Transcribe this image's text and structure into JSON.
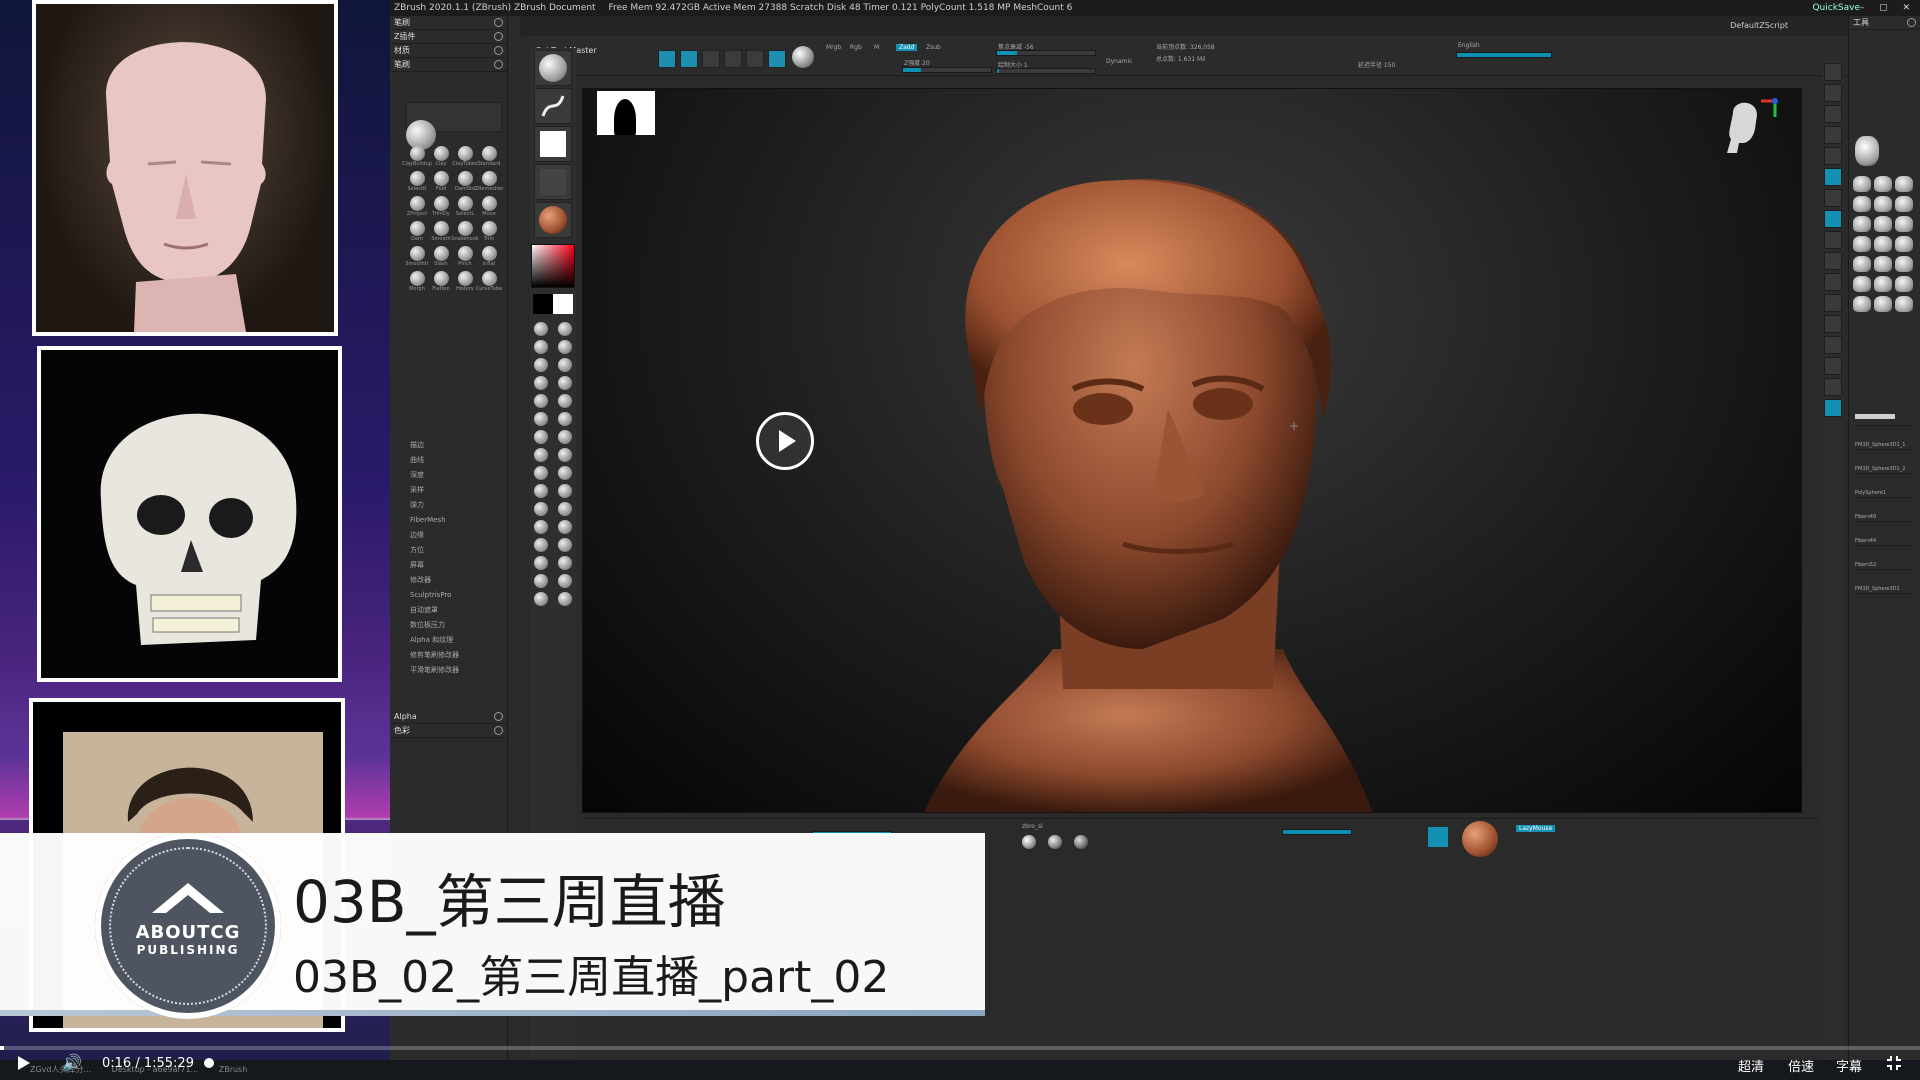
{
  "window": {
    "title": "ZBrush 2020.1.1 (ZBrush)  ZBrush Document",
    "status": "Free Mem 92.472GB  Active Mem 27388  Scratch Disk 48  Timer 0.121  PolyCount 1.518 MP  MeshCount 6",
    "quicksave": "QuickSave",
    "script": "DefaultZScript"
  },
  "left_tray": {
    "sections": [
      "笔刷",
      "Z插件",
      "材质",
      "笔刷"
    ],
    "brushes": [
      "ClayBuildup",
      "Clay",
      "ClayTubes",
      "Standard",
      "SelectR",
      "Fold",
      "DamStd",
      "ZRemesher",
      "ZProject",
      "TrimDy",
      "SelectL",
      "Move",
      "Dam",
      "Smooth",
      "Snakehook",
      "Trim",
      "Smoothtr",
      "Slash",
      "Pinch",
      "Inflat",
      "Morph",
      "Flatten",
      "History",
      "CurveTube"
    ],
    "submenu": [
      "描边",
      "曲线",
      "深度",
      "采样",
      "弹力",
      "FiberMesh",
      "边缘",
      "方位",
      "屏幕",
      "修改器",
      "SculptrisPro",
      "自动遮罩",
      "数位板压力",
      "Alpha 和纹理",
      "修剪笔刷修改器",
      "平滑笔刷修改器"
    ],
    "bottom_sections": [
      "Alpha",
      "色彩"
    ]
  },
  "top_shelf": {
    "subtool_master": "SubTool Master",
    "mrgb": "Mrgb",
    "rgb": "Rgb",
    "m": "M",
    "zadd": "Zadd",
    "zsub": "Zsub",
    "focal": "焦点衰减 -56",
    "draw_size": "绘制大小 1",
    "dynamic": "Dynamic",
    "active_points": "当前顶点数: 326,058",
    "total_points": "总点数: 1.631 Mil",
    "intensity": "Z强度 20",
    "language": "English",
    "lazy": "延迟半径 150"
  },
  "viewport": {
    "cursor": "+"
  },
  "right_tray": {
    "header": "工具",
    "subtools": [
      "PM3D_Sphere3D1_1",
      "PM3D_Sphere3D1_2",
      "PolySphere1",
      "Fibers49",
      "Fibers44",
      "Fibers52",
      "PM3D_Sphere3D1"
    ]
  },
  "bottom_shelf": {
    "material": "zbro_sl",
    "lazy_mouse": "LazyMouse"
  },
  "overlay": {
    "logo_line1": "ABOUTCG",
    "logo_line2": "PUBLISHING",
    "title": "03B_第三周直播",
    "subtitle": "03B_02_第三周直播_part_02"
  },
  "player": {
    "current_time": "0:16",
    "duration": "1:55:29",
    "progress_fraction": 0.0023,
    "quality": "超清",
    "speed": "倍速",
    "subtitles": "字幕"
  },
  "taskbar": {
    "items": [
      "ZGvd人头库分...",
      "Desktop - a6e9af71...",
      "ZBrush"
    ]
  }
}
